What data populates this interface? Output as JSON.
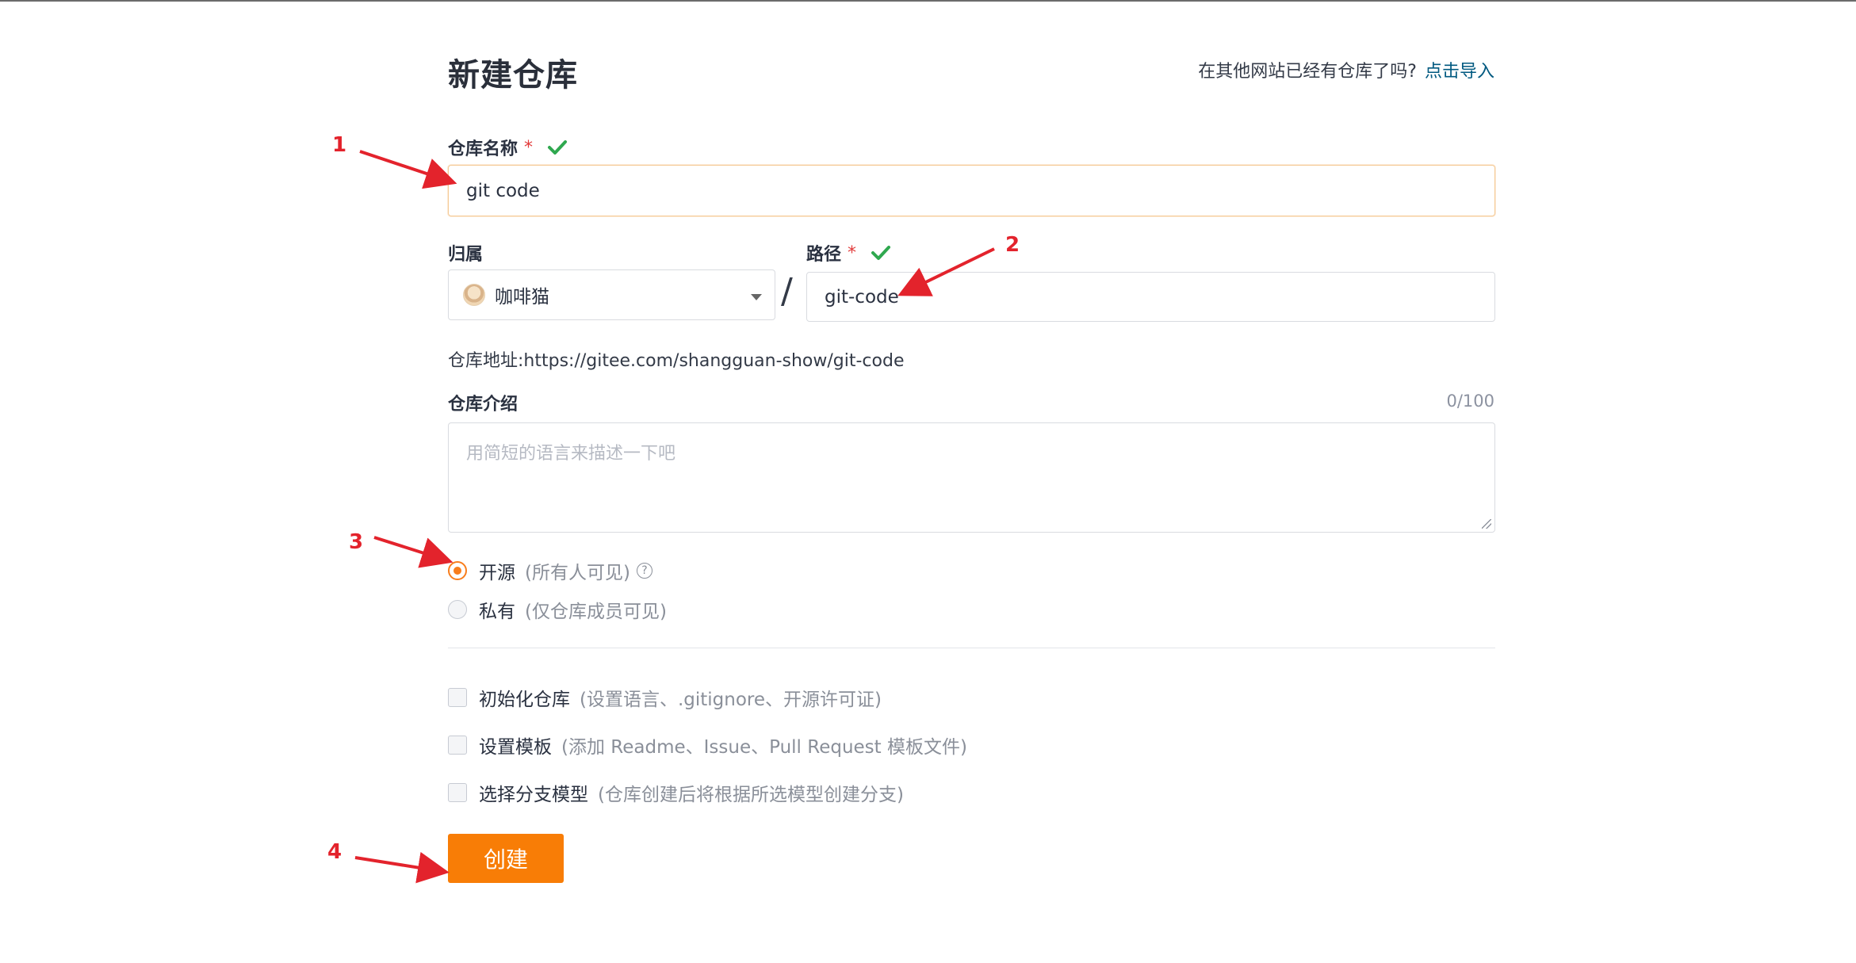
{
  "page": {
    "title": "新建仓库",
    "import_prompt": "在其他网站已经有仓库了吗?",
    "import_link": "点击导入"
  },
  "repo_name": {
    "label": "仓库名称",
    "required_mark": "*",
    "value": "git code"
  },
  "owner": {
    "label": "归属",
    "value": "咖啡猫"
  },
  "separator": "/",
  "path": {
    "label": "路径",
    "required_mark": "*",
    "value": "git-code"
  },
  "repo_url": {
    "label": "仓库地址:",
    "value": "https://gitee.com/shangguan-show/git-code"
  },
  "description": {
    "label": "仓库介绍",
    "counter": "0/100",
    "placeholder": "用简短的语言来描述一下吧",
    "value": ""
  },
  "visibility": {
    "selected": "open",
    "options": [
      {
        "id": "open",
        "label": "开源",
        "hint": "(所有人可见)"
      },
      {
        "id": "private",
        "label": "私有",
        "hint": "(仅仓库成员可见)"
      }
    ]
  },
  "options": [
    {
      "label": "初始化仓库",
      "hint": "(设置语言、.gitignore、开源许可证)",
      "checked": false
    },
    {
      "label": "设置模板",
      "hint": "(添加 Readme、Issue、Pull Request 模板文件)",
      "checked": false
    },
    {
      "label": "选择分支模型",
      "hint": "(仓库创建后将根据所选模型创建分支)",
      "checked": false
    }
  ],
  "submit": {
    "label": "创建"
  },
  "annotations": [
    "1",
    "2",
    "3",
    "4"
  ],
  "colors": {
    "accent": "#f87d06",
    "link": "#005980",
    "required": "#e23b3b",
    "check": "#2fa84f",
    "annotation": "#e3232c"
  },
  "icons": {
    "valid": "check-icon",
    "help": "help-icon",
    "dropdown": "chevron-down-icon"
  }
}
